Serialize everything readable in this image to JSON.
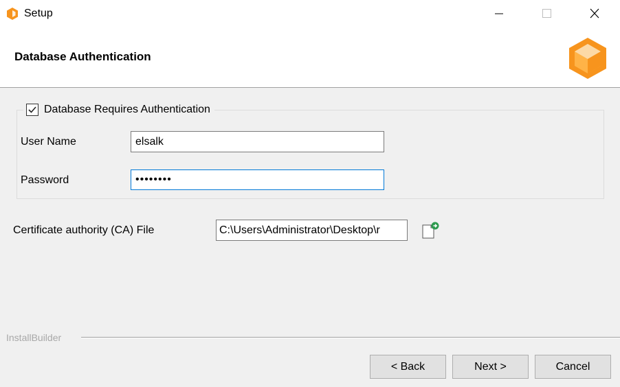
{
  "window": {
    "title": "Setup",
    "minimize_glyph": "–",
    "maximize_glyph": "☐",
    "close_glyph": "✕"
  },
  "header": {
    "title": "Database Authentication",
    "logo_icon": "installbuilder-box-logo",
    "accent_color": "#f7941d"
  },
  "auth_group": {
    "checkbox_label": "Database Requires Authentication",
    "checkbox_checked": true,
    "username": {
      "label": "User Name",
      "value": "elsalk"
    },
    "password": {
      "label": "Password",
      "value": "••••••••"
    }
  },
  "certificate": {
    "label": "Certificate authority (CA) File",
    "value": "C:\\Users\\Administrator\\Desktop\\r",
    "browse_icon": "browse-file-icon"
  },
  "footer": {
    "brand": "InstallBuilder",
    "back_label": "< Back",
    "next_label": "Next >",
    "cancel_label": "Cancel"
  }
}
